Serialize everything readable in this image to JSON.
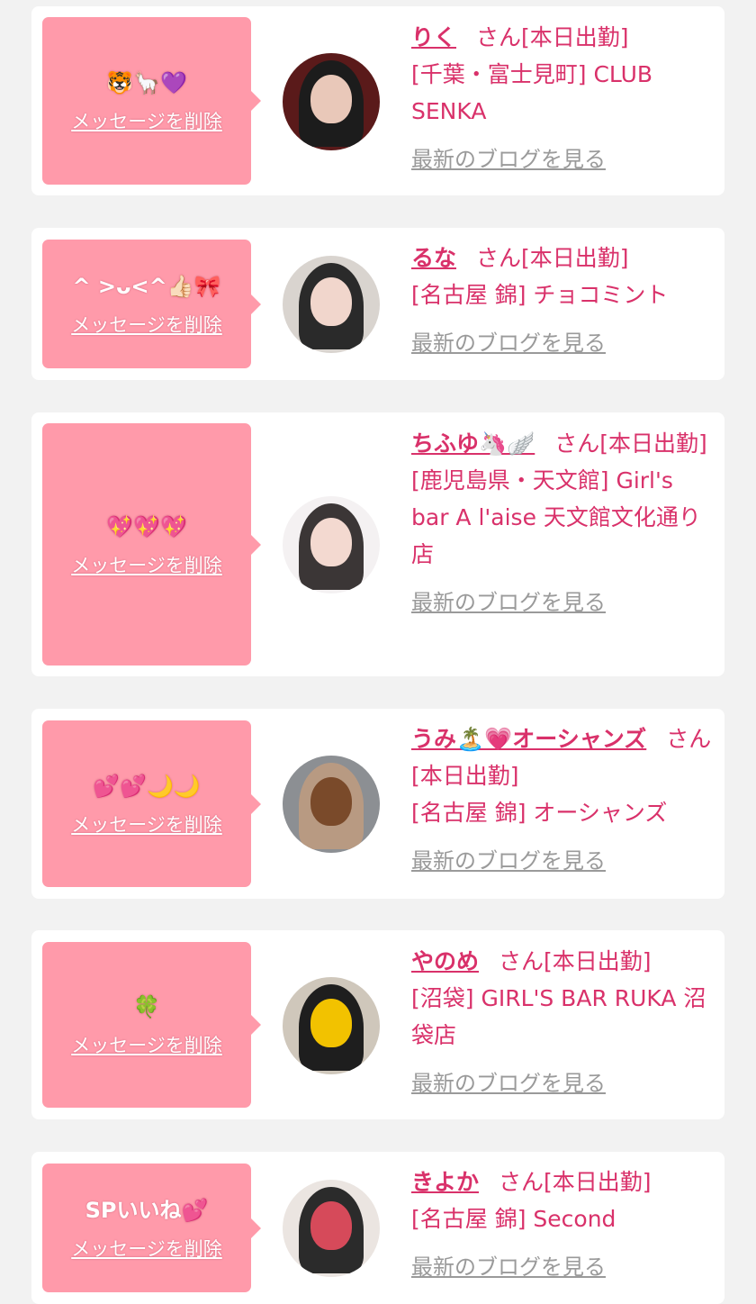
{
  "delete_label": "メッセージを削除",
  "san_suffix": "さん",
  "status": "[本日出勤]",
  "blog_label": "最新のブログを見る",
  "colors": {
    "background": "#f2f2f2",
    "card": "#ffffff",
    "bubble": "#ff9aaa",
    "accent": "#d9316a",
    "link_gray": "#9a9a9a"
  },
  "entries": [
    {
      "message": "🐯🦙💜",
      "name": "りく",
      "shop": "[千葉・富士見町] CLUB SENKA",
      "avatar": {
        "bg": "#5a1a1a",
        "hair": "#1c1c1c",
        "skin": "#e9c8b9"
      }
    },
    {
      "message": "^ >ᴗ<^👍🏻🎀",
      "name": "るな",
      "shop": "[名古屋 錦] チョコミント",
      "avatar": {
        "bg": "#d9d4cf",
        "hair": "#2a2a2a",
        "skin": "#f1d6cc"
      }
    },
    {
      "message": "💖💖💖",
      "name": "ちふゆ🦄🪽",
      "shop": "[鹿児島県・天文館] Girl's bar A l'aise 天文館文化通り店",
      "avatar": {
        "bg": "#f4f1f2",
        "hair": "#3b3636",
        "skin": "#f3d9d0"
      }
    },
    {
      "message": "💕💕🌙🌙",
      "name": "うみ🏝️💗オーシャンズ",
      "shop": "[名古屋 錦] オーシャンズ",
      "avatar": {
        "bg": "#8c8f93",
        "hair": "#b89a82",
        "skin": "#7a4a2a"
      }
    },
    {
      "message": "🍀",
      "name": "やのめ",
      "shop": "[沼袋] GIRL'S BAR RUKA 沼袋店",
      "avatar": {
        "bg": "#cfc7bb",
        "hair": "#1e1e1e",
        "skin": "#f2c200"
      }
    },
    {
      "message": "SPいいね💕",
      "name": "きよか",
      "shop": "[名古屋 錦] Second",
      "avatar": {
        "bg": "#ebe5e1",
        "hair": "#2b2b2b",
        "skin": "#d64a5a"
      }
    }
  ]
}
